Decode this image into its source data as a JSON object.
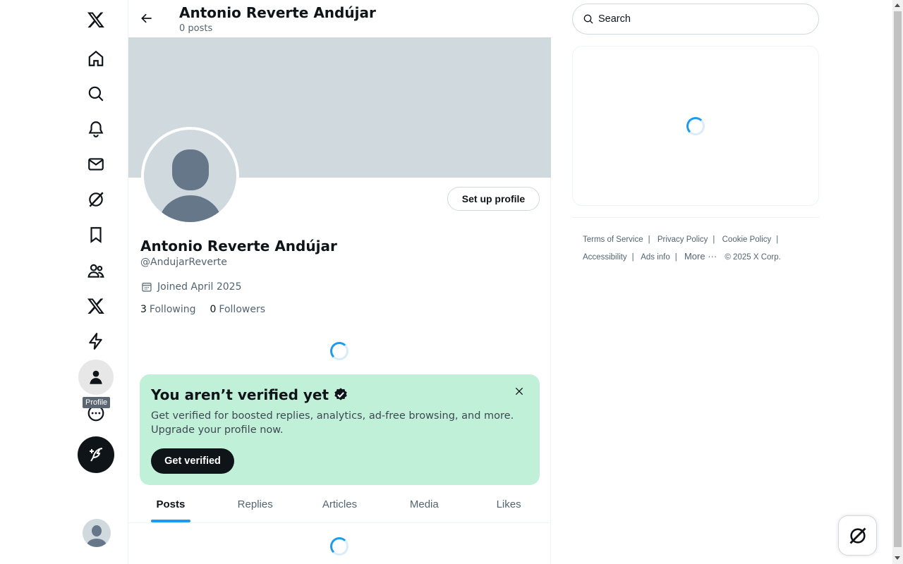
{
  "nav": {
    "items": [
      {
        "icon": "x-logo-icon"
      },
      {
        "icon": "home-icon"
      },
      {
        "icon": "explore-icon"
      },
      {
        "icon": "notifications-icon"
      },
      {
        "icon": "messages-icon"
      },
      {
        "icon": "grok-icon"
      },
      {
        "icon": "bookmarks-icon"
      },
      {
        "icon": "communities-icon"
      },
      {
        "icon": "premium-icon"
      },
      {
        "icon": "verified-orgs-icon"
      },
      {
        "icon": "profile-icon"
      },
      {
        "icon": "more-icon"
      }
    ],
    "tooltip": "Profile"
  },
  "header": {
    "title": "Antonio Reverte Andújar",
    "subtitle": "0 posts"
  },
  "profile": {
    "setup_button": "Set up profile",
    "name": "Antonio Reverte Andújar",
    "handle": "@AndujarReverte",
    "joined": "Joined April 2025",
    "following_count": "3",
    "following_label": "Following",
    "followers_count": "0",
    "followers_label": "Followers"
  },
  "verify_card": {
    "title": "You aren’t verified yet",
    "body": "Get verified for boosted replies, analytics, ad-free browsing, and more. Upgrade your profile now.",
    "button": "Get verified"
  },
  "tabs": [
    {
      "label": "Posts",
      "active": true
    },
    {
      "label": "Replies"
    },
    {
      "label": "Articles"
    },
    {
      "label": "Media"
    },
    {
      "label": "Likes"
    }
  ],
  "search": {
    "placeholder": "Search"
  },
  "footer": {
    "links": [
      "Terms of Service",
      "Privacy Policy",
      "Cookie Policy",
      "Accessibility",
      "Ads info",
      "More ···"
    ],
    "copyright": "© 2025 X Corp."
  },
  "colors": {
    "accent": "#1d9bf0",
    "verify_bg": "#c1f0d9",
    "banner": "#cfd9de"
  }
}
